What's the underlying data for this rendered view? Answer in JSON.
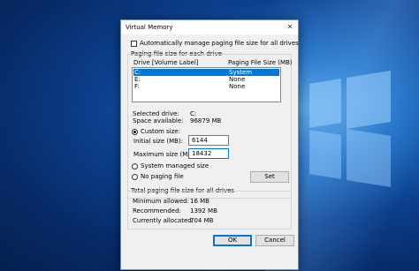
{
  "window": {
    "title": "Virtual Memory",
    "close_glyph": "✕"
  },
  "auto_manage": {
    "label": "Automatically manage paging file size for all drives",
    "checked": false
  },
  "drives_group": {
    "label": "Paging file size for each drive",
    "col_drive": "Drive  [Volume Label]",
    "col_size": "Paging File Size (MB)",
    "rows": [
      {
        "drive": "C:",
        "size": "System managed",
        "selected": true
      },
      {
        "drive": "E:",
        "size": "None",
        "selected": false
      },
      {
        "drive": "F:",
        "size": "None",
        "selected": false
      }
    ],
    "selected_drive_label": "Selected drive:",
    "selected_drive_value": "C:",
    "space_label": "Space available:",
    "space_value": "96879 MB",
    "custom_size": "Custom size:",
    "initial_label": "Initial size (MB):",
    "initial_value": "6144",
    "max_label": "Maximum size (MB):",
    "max_value": "18432",
    "system_managed": "System managed size",
    "no_paging": "No paging file",
    "set_button": "Set"
  },
  "totals_group": {
    "label": "Total paging file size for all drives",
    "min_label": "Minimum allowed:",
    "min_value": "16 MB",
    "rec_label": "Recommended:",
    "rec_value": "1392 MB",
    "cur_label": "Currently allocated:",
    "cur_value": "704 MB"
  },
  "buttons": {
    "ok": "OK",
    "cancel": "Cancel"
  }
}
